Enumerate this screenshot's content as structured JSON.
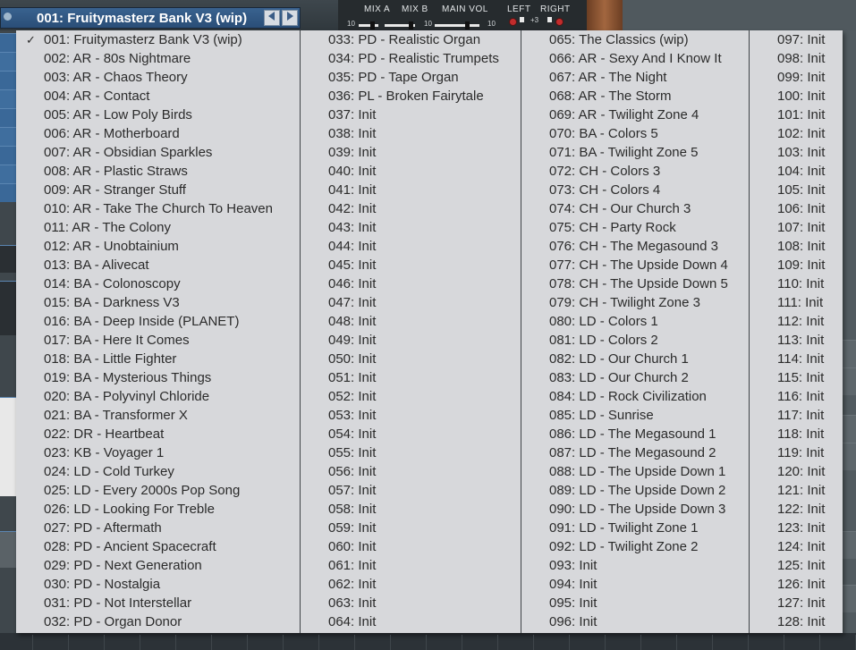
{
  "header": {
    "current_preset": "001: Fruitymasterz Bank V3 (wip)",
    "prev_icon": "triangle-left-icon",
    "next_icon": "triangle-right-icon",
    "mixer": {
      "mix_a": "MIX A",
      "mix_b": "MIX B",
      "main_vol": "MAIN VOL",
      "left": "LEFT",
      "right": "RIGHT",
      "scale_a_low": "10",
      "scale_a_high": "10",
      "scale_b_high": "10",
      "scale_vol_high": "10",
      "pan_value": "+3"
    }
  },
  "colors": {
    "menu_bg": "#d7d8db",
    "menu_text": "#2b2b2b",
    "preset_bar": "#2f5683"
  },
  "menu": {
    "selected_index": 0,
    "check_mark": "✓",
    "columns": [
      [
        "001: Fruitymasterz Bank V3 (wip)",
        "002: AR - 80s Nightmare",
        "003: AR - Chaos Theory",
        "004: AR - Contact",
        "005: AR - Low Poly Birds",
        "006: AR - Motherboard",
        "007: AR - Obsidian Sparkles",
        "008: AR - Plastic Straws",
        "009: AR - Stranger Stuff",
        "010: AR - Take The Church To Heaven",
        "011: AR - The Colony",
        "012: AR - Unobtainium",
        "013: BA - Alivecat",
        "014: BA - Colonoscopy",
        "015: BA - Darkness V3",
        "016: BA - Deep Inside (PLANET)",
        "017: BA - Here It Comes",
        "018: BA - Little Fighter",
        "019: BA - Mysterious Things",
        "020: BA - Polyvinyl Chloride",
        "021: BA - Transformer X",
        "022: DR - Heartbeat",
        "023: KB - Voyager 1",
        "024: LD - Cold Turkey",
        "025: LD - Every 2000s Pop Song",
        "026: LD - Looking For Treble",
        "027: PD - Aftermath",
        "028: PD - Ancient Spacecraft",
        "029: PD - Next Generation",
        "030: PD - Nostalgia",
        "031: PD - Not Interstellar",
        "032: PD - Organ Donor"
      ],
      [
        "033: PD - Realistic Organ",
        "034: PD - Realistic Trumpets",
        "035: PD - Tape Organ",
        "036: PL - Broken Fairytale",
        "037: Init",
        "038: Init",
        "039: Init",
        "040: Init",
        "041: Init",
        "042: Init",
        "043: Init",
        "044: Init",
        "045: Init",
        "046: Init",
        "047: Init",
        "048: Init",
        "049: Init",
        "050: Init",
        "051: Init",
        "052: Init",
        "053: Init",
        "054: Init",
        "055: Init",
        "056: Init",
        "057: Init",
        "058: Init",
        "059: Init",
        "060: Init",
        "061: Init",
        "062: Init",
        "063: Init",
        "064: Init"
      ],
      [
        "065: The Classics (wip)",
        "066: AR - Sexy And I Know It",
        "067: AR - The Night",
        "068: AR - The Storm",
        "069: AR - Twilight Zone 4",
        "070: BA - Colors 5",
        "071: BA - Twilight Zone 5",
        "072: CH - Colors 3",
        "073: CH - Colors 4",
        "074: CH - Our Church 3",
        "075: CH - Party Rock",
        "076: CH - The Megasound 3",
        "077: CH - The Upside Down 4",
        "078: CH - The Upside Down 5",
        "079: CH - Twilight Zone 3",
        "080: LD - Colors 1",
        "081: LD - Colors 2",
        "082: LD - Our Church 1",
        "083: LD - Our Church 2",
        "084: LD - Rock Civilization",
        "085: LD - Sunrise",
        "086: LD - The Megasound 1",
        "087: LD - The Megasound 2",
        "088: LD - The Upside Down 1",
        "089: LD - The Upside Down 2",
        "090: LD - The Upside Down 3",
        "091: LD - Twilight Zone 1",
        "092: LD - Twilight Zone 2",
        "093: Init",
        "094: Init",
        "095: Init",
        "096: Init"
      ],
      [
        "097: Init",
        "098: Init",
        "099: Init",
        "100: Init",
        "101: Init",
        "102: Init",
        "103: Init",
        "104: Init",
        "105: Init",
        "106: Init",
        "107: Init",
        "108: Init",
        "109: Init",
        "110: Init",
        "111: Init",
        "112: Init",
        "113: Init",
        "114: Init",
        "115: Init",
        "116: Init",
        "117: Init",
        "118: Init",
        "119: Init",
        "120: Init",
        "121: Init",
        "122: Init",
        "123: Init",
        "124: Init",
        "125: Init",
        "126: Init",
        "127: Init",
        "128: Init"
      ]
    ]
  }
}
